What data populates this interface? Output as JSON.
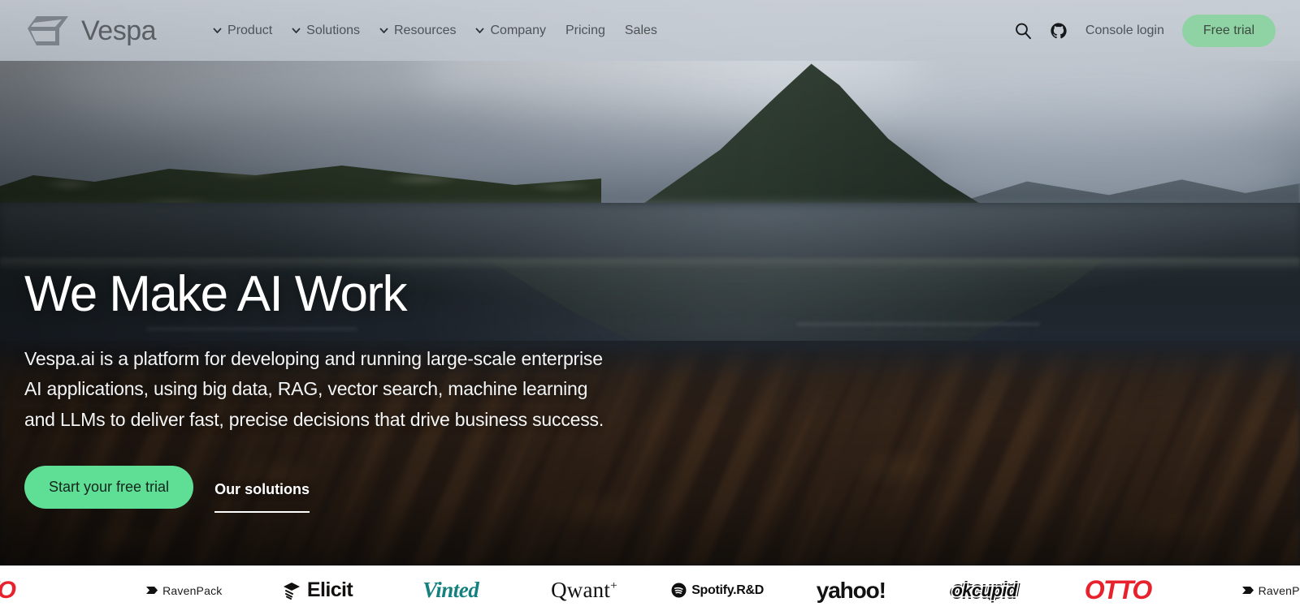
{
  "header": {
    "brand_name": "Vespa",
    "nav_items": [
      {
        "label": "Product",
        "has_dropdown": true
      },
      {
        "label": "Solutions",
        "has_dropdown": true
      },
      {
        "label": "Resources",
        "has_dropdown": true
      },
      {
        "label": "Company",
        "has_dropdown": true
      },
      {
        "label": "Pricing",
        "has_dropdown": false
      },
      {
        "label": "Sales",
        "has_dropdown": false
      }
    ],
    "search_icon": "search-icon",
    "github_icon": "github-icon",
    "console_login_label": "Console login",
    "free_trial_label": "Free trial",
    "free_trial_color": "#8fd3a4",
    "background_color": "#c7cdd4"
  },
  "hero": {
    "title": "We Make AI Work",
    "subtitle": "Vespa.ai is a platform for developing and running large-scale enterprise AI applications, using big data, RAG, vector search, machine learning and LLMs to deliver fast, precise decisions that drive business success.",
    "subtitle_lines": [
      "Vespa.ai is a platform for developing and running large-scale enterprise",
      "AI applications, using big data, RAG, vector search, machine learning",
      "and LLMs to deliver fast, precise decisions that drive business success."
    ],
    "primary_cta": "Start your free trial",
    "primary_cta_color": "#5fde95",
    "secondary_cta": "Our solutions",
    "background_description": "Dark moody photograph of a green mountain peak above a still fjord lake with submerged brown stones in the foreground"
  },
  "logo_strip": {
    "background_color": "#ffffff",
    "logos": [
      {
        "name": "OTTO",
        "display": "TO",
        "color": "#e8222d",
        "partial": true
      },
      {
        "name": "RavenPack",
        "display": "RavenPack",
        "color": "#1b1b1b",
        "partial": false
      },
      {
        "name": "Elicit",
        "display": "Elicit",
        "color": "#12100e",
        "partial": false
      },
      {
        "name": "Vinted",
        "display": "Vinted",
        "color": "#14817e",
        "partial": false
      },
      {
        "name": "Qwant",
        "display": "Qwant",
        "color": "#111111",
        "partial": false,
        "superscript": "+"
      },
      {
        "name": "Spotify R&D",
        "display": "Spotify.R&D",
        "color": "#0f0f0f",
        "partial": false
      },
      {
        "name": "yahoo!",
        "display": "yahoo!",
        "color": "#121212",
        "partial": false
      },
      {
        "name": "okcupid",
        "display": "okcupid",
        "color": "#111111",
        "partial": false
      },
      {
        "name": "OTTO",
        "display": "OTTO",
        "color": "#e8222d",
        "partial": false
      },
      {
        "name": "RavenPack",
        "display": "RavenPack",
        "color": "#1b1b1b",
        "partial": false
      }
    ]
  }
}
